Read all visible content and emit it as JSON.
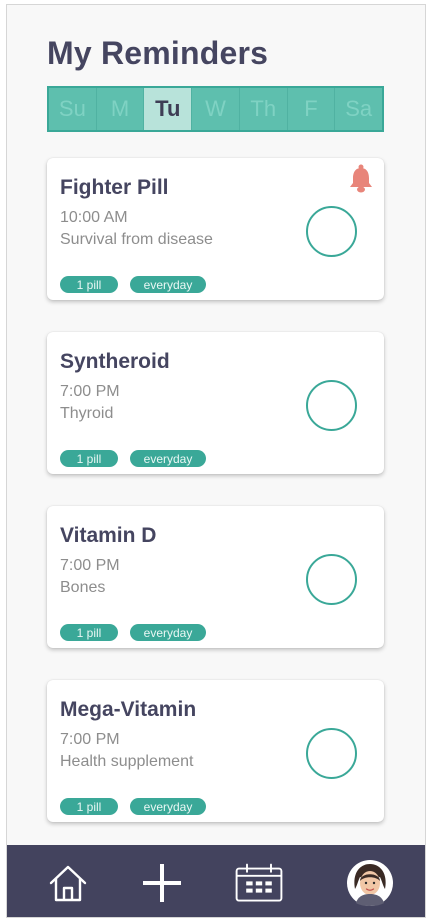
{
  "header": {
    "title": "My Reminders"
  },
  "days": [
    {
      "label": "Su",
      "active": false
    },
    {
      "label": "M",
      "active": false
    },
    {
      "label": "Tu",
      "active": true
    },
    {
      "label": "W",
      "active": false
    },
    {
      "label": "Th",
      "active": false
    },
    {
      "label": "F",
      "active": false
    },
    {
      "label": "Sa",
      "active": false
    }
  ],
  "reminders": [
    {
      "name": "Fighter Pill",
      "time": "10:00 AM",
      "description": "Survival from disease",
      "quantity": "1 pill",
      "frequency": "everyday",
      "alert": true
    },
    {
      "name": "Syntheroid",
      "time": "7:00 PM",
      "description": "Thyroid",
      "quantity": "1 pill",
      "frequency": "everyday",
      "alert": false
    },
    {
      "name": "Vitamin D",
      "time": "7:00 PM",
      "description": "Bones",
      "quantity": "1 pill",
      "frequency": "everyday",
      "alert": false
    },
    {
      "name": "Mega-Vitamin",
      "time": "7:00 PM",
      "description": "Health supplement",
      "quantity": "1 pill",
      "frequency": "everyday",
      "alert": false
    }
  ],
  "nav": {
    "items": [
      {
        "icon": "home-icon"
      },
      {
        "icon": "plus-icon"
      },
      {
        "icon": "calendar-icon"
      },
      {
        "icon": "avatar"
      }
    ]
  },
  "colors": {
    "accent": "#3aa898",
    "title": "#454560",
    "navbar": "#43435e",
    "alert": "#e8857a"
  }
}
